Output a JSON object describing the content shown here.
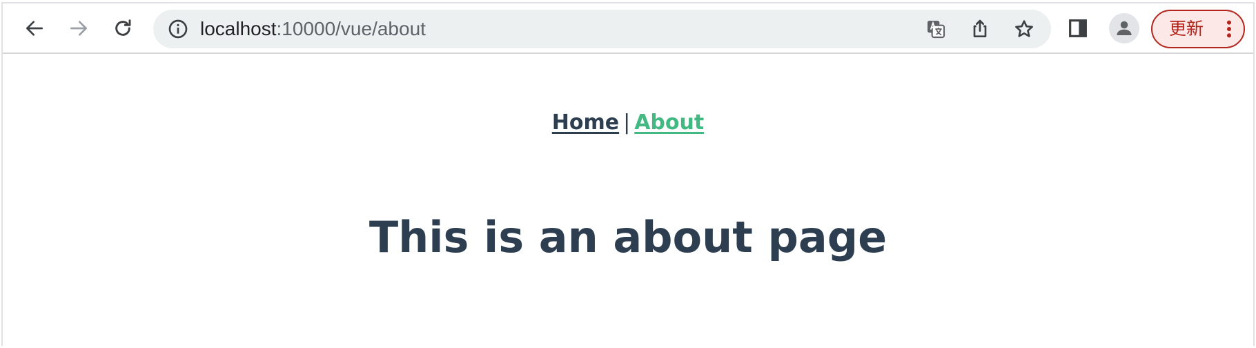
{
  "browser": {
    "url_host": "localhost",
    "url_path": ":10000/vue/about",
    "update_label": "更新",
    "icons": {
      "back": "arrow-left-icon",
      "forward": "arrow-right-icon",
      "reload": "reload-icon",
      "site_info": "info-icon",
      "translate": "translate-icon",
      "share": "share-icon",
      "bookmark": "star-icon",
      "side_panel": "side-panel-icon",
      "profile": "avatar-icon",
      "menu": "more-vert-icon"
    },
    "colors": {
      "update_accent": "#b3261e",
      "update_bg": "#fce8e6",
      "omnibox_bg": "#edf0f1"
    }
  },
  "app": {
    "nav": {
      "home_label": "Home",
      "separator": "|",
      "about_label": "About",
      "active": "About"
    },
    "heading": "This is an about page",
    "colors": {
      "text": "#2c3e50",
      "active_link": "#42b983"
    }
  }
}
